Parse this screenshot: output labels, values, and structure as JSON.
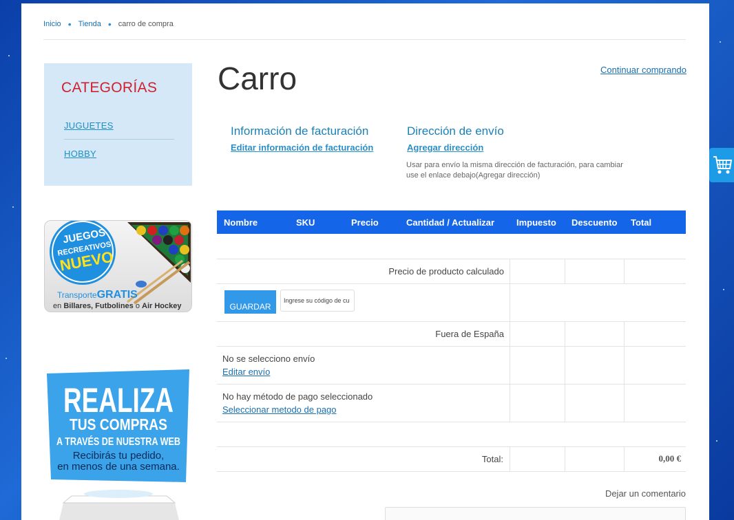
{
  "breadcrumb": {
    "home": "Inicio",
    "shop": "Tienda",
    "current": "carro de compra"
  },
  "sidebar": {
    "title": "CATEGORÍAS",
    "items": [
      {
        "label": "JUGUETES"
      },
      {
        "label": "HOBBY"
      }
    ]
  },
  "banner1": {
    "line1": "JUEGOS",
    "line2": "RECREATIVOS",
    "line3": "NUEVO",
    "shipping_a": "Transporte",
    "shipping_b": "GRATIS",
    "products_a": "en",
    "products_b": "Billares, Futbolines",
    "products_c": "o",
    "products_d": "Air Hockey"
  },
  "banner2": {
    "line1": "REALIZA",
    "line2": "TUS COMPRAS",
    "line3": "A TRAVÉS DE NUESTRA WEB",
    "line4": "Recibirás tu pedido,",
    "line5": "en menos de una semana."
  },
  "page": {
    "title": "Carro",
    "continue": "Continuar comprando"
  },
  "billing": {
    "title": "Información de facturación",
    "link": "Editar información de facturación"
  },
  "shipping_address": {
    "title": "Dirección de envío",
    "link": "Agregar dirección",
    "note": "Usar para envío la misma dirección de facturación, para cambiar use el enlace debajo(Agregar dirección)"
  },
  "table": {
    "headers": {
      "name": "Nombre",
      "sku": "SKU",
      "price": "Precio",
      "qty": "Cantidad / Actualizar",
      "tax": "Impuesto",
      "discount": "Descuento",
      "total": "Total"
    },
    "calculated_label": "Precio de producto calculado",
    "save_button": "GUARDAR",
    "coupon_value": "Ingrese su código de cu",
    "outside_label": "Fuera de España",
    "no_shipping": "No se selecciono envío",
    "edit_shipping": "Editar envío",
    "no_payment": "No hay método de pago seleccionado",
    "select_payment": "Seleccionar metodo de pago",
    "total_label": "Total:",
    "total_value": "0,00 €"
  },
  "comment": {
    "label": "Dejar un comentario"
  },
  "colors": {
    "header_blue": "#1565e8",
    "link": "#1a6fb0",
    "category_red": "#d0202e",
    "button_blue": "#3298e8"
  },
  "icons": {
    "cart_tab": "shopping-cart-icon"
  }
}
